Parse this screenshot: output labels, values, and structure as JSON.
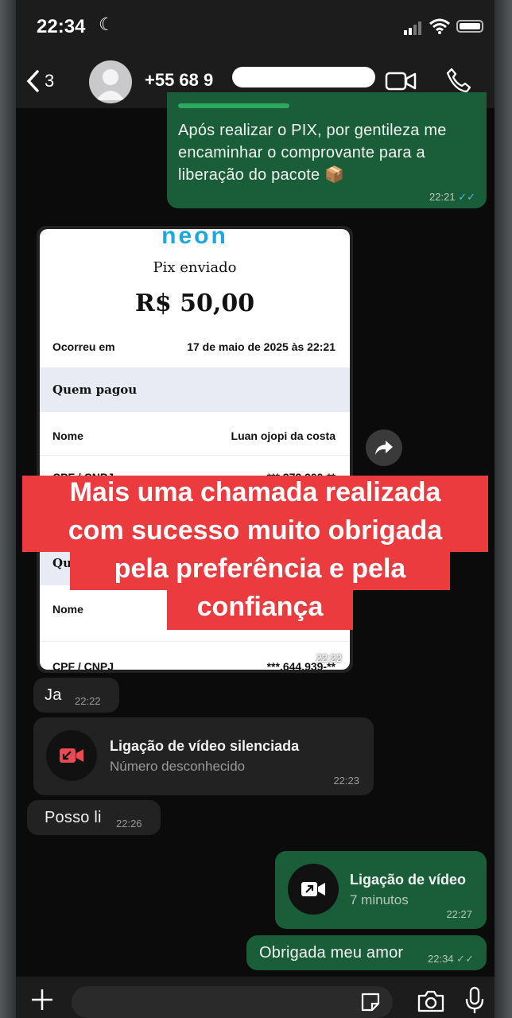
{
  "status_bar": {
    "time": "22:34",
    "moon": "☾"
  },
  "header": {
    "back_count": "3",
    "contact_name": "+55 68 9"
  },
  "messages": {
    "m1": {
      "text": "Após realizar o PIX, por gentileza me encaminhar o comprovante para a liberação do pacote 📦",
      "time": "22:21"
    },
    "receipt": {
      "brand": "neon",
      "title": "Pix enviado",
      "amount": "R$ 50,00",
      "rows": [
        {
          "label": "Ocorreu em",
          "value": "17 de maio de 2025 às 22:21"
        },
        {
          "label": "Nome",
          "value": "Luan ojopi da costa"
        },
        {
          "label": "CPF / CNPJ",
          "value": "***.372.200-**"
        },
        {
          "label": "Nome",
          "value": ""
        },
        {
          "label": "CPF / CNPJ",
          "value": "***.644.939-**"
        }
      ],
      "section1": "Quem pagou",
      "section2": "Quem recebeu",
      "time": "22:22"
    },
    "m2": {
      "text": "Ja",
      "time": "22:22"
    },
    "m3": {
      "title": "Ligação de vídeo silenciada",
      "subtitle": "Número desconhecido",
      "time": "22:23"
    },
    "m4": {
      "text": "Posso li",
      "time": "22:26"
    },
    "m5": {
      "title": "Ligação de vídeo",
      "subtitle": "7 minutos",
      "time": "22:27"
    },
    "m6": {
      "text": "Obrigada meu amor",
      "time": "22:34"
    }
  },
  "overlay": {
    "line1": "Mais uma chamada realizada",
    "line2": "com sucesso muito obrigada",
    "line3": "pela preferência e pela",
    "line4": "confiança"
  },
  "colors": {
    "outgoing": "#1a5d39",
    "incoming": "#222222",
    "overlay": "#ec3b3f",
    "read_ticks": "#4fb6ec",
    "missed_call": "#e94a53"
  }
}
